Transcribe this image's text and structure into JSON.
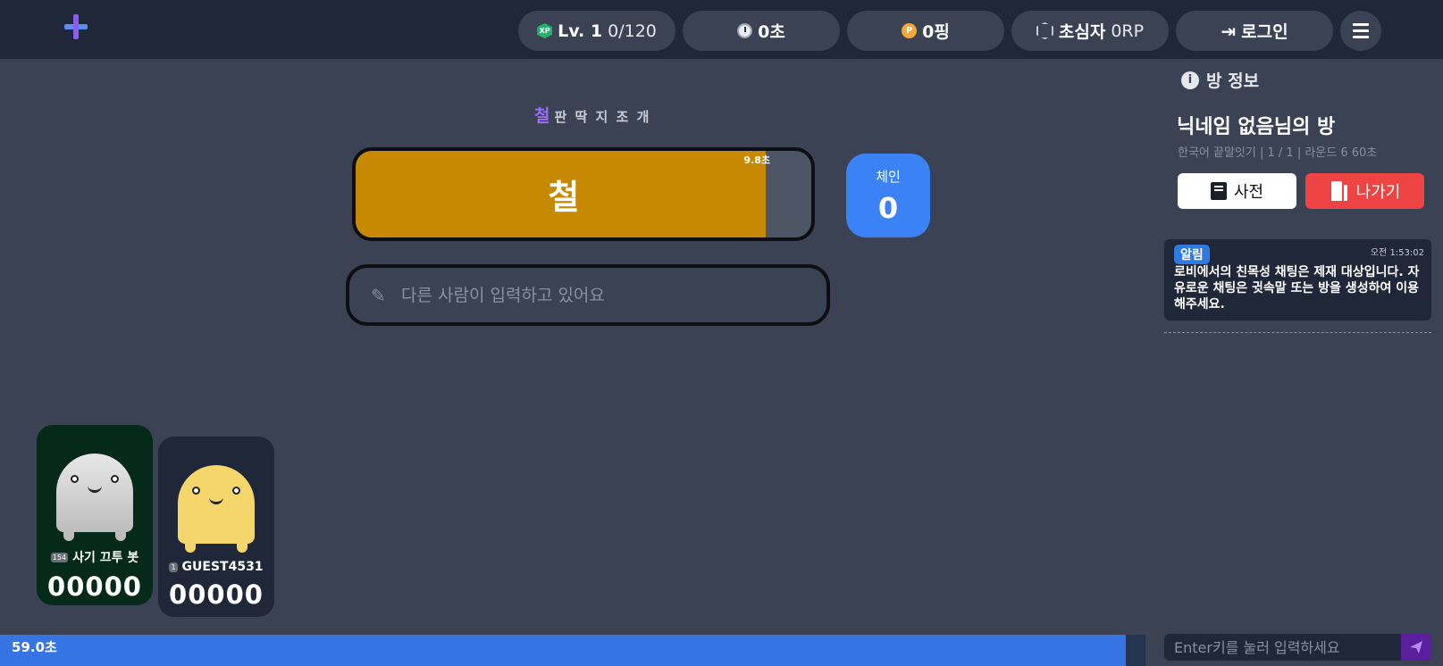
{
  "topbar": {
    "level": "Lv. 1",
    "xp": "0/120",
    "time": "0초",
    "points": "0핑",
    "rank": "초심자",
    "rp": "0RP",
    "login_label": "로그인",
    "xp_icon_text": "XP",
    "coin_icon_text": "P"
  },
  "game": {
    "chain_first": "철",
    "chain_rest": "판 딱 지 조 개",
    "current_word": "철",
    "word_timer": "9.8초",
    "word_timer_ratio": 0.9,
    "chain_label": "체인",
    "chain_value": "0",
    "input_placeholder": "다른 사람이 입력하고 있어요",
    "round_timer": "59.0초",
    "round_timer_ratio": 0.983
  },
  "players": [
    {
      "level": "154",
      "name": "사기 끄투 봇",
      "score": "00000"
    },
    {
      "level": "1",
      "name": "GUEST4531",
      "score": "00000"
    }
  ],
  "room": {
    "section_title": "방 정보",
    "title": "닉네임 없음님의 방",
    "meta": "한국어 끝말잇기 | 1 / 1 | 라운드 6 60초",
    "dict_label": "사전",
    "exit_label": "나가기"
  },
  "notice": {
    "badge": "알림",
    "time": "오전 1:53:02",
    "text": "로비에서의 친목성 채팅은 제재 대상입니다. 자유로운 채팅은 귓속말 또는 방을 생성하여 이용해주세요."
  },
  "chat": {
    "placeholder": "Enter키를 눌러 입력하세요"
  },
  "colors": {
    "background": "#3a4254",
    "topbar": "#1f2738",
    "word_fill": "#c78802",
    "chain_box": "#3b82f6",
    "exit_button": "#ef4444",
    "timer_fill": "#3574e2"
  }
}
